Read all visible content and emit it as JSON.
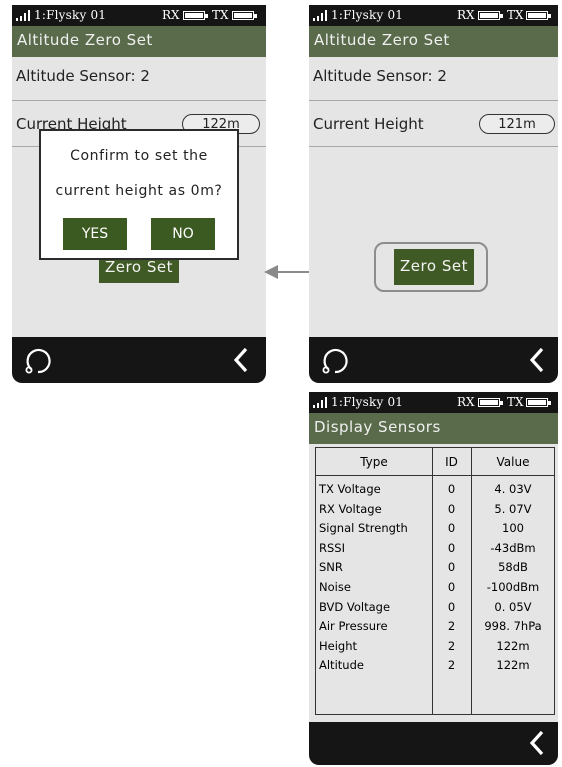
{
  "status_bar": {
    "model_name": "1:Flysky 01",
    "rx_label": "RX",
    "tx_label": "TX"
  },
  "screen_a": {
    "title": "Altitude Zero Set",
    "sensor_label": "Altitude Sensor: 2",
    "height_label": "Current Height",
    "height_value": "122m",
    "zero_button": "Zero Set",
    "dialog": {
      "line1": "Confirm to set the",
      "line2": "current height as 0m?",
      "yes": "YES",
      "no": "NO"
    }
  },
  "screen_b": {
    "title": "Altitude Zero Set",
    "sensor_label": "Altitude Sensor: 2",
    "height_label": "Current Height",
    "height_value": "121m",
    "zero_button": "Zero Set"
  },
  "screen_c": {
    "title": "Display Sensors",
    "columns": [
      "Type",
      "ID",
      "Value"
    ],
    "rows": [
      {
        "type": "TX Voltage",
        "id": "0",
        "value": "4. 03V"
      },
      {
        "type": "RX Voltage",
        "id": "0",
        "value": "5. 07V"
      },
      {
        "type": "Signal Strength",
        "id": "0",
        "value": "100"
      },
      {
        "type": "RSSI",
        "id": "0",
        "value": "-43dBm"
      },
      {
        "type": "SNR",
        "id": "0",
        "value": "58dB"
      },
      {
        "type": "Noise",
        "id": "0",
        "value": "-100dBm"
      },
      {
        "type": "BVD Voltage",
        "id": "0",
        "value": "0. 05V"
      },
      {
        "type": "Air Pressure",
        "id": "2",
        "value": "998. 7hPa"
      },
      {
        "type": "Height",
        "id": "2",
        "value": "122m"
      },
      {
        "type": "Altitude",
        "id": "2",
        "value": "122m"
      }
    ]
  },
  "colors": {
    "title_bar": "#5a6b4b",
    "button": "#3f5a24",
    "screen_bg": "#e5e5e5",
    "bar_bg": "#151515"
  },
  "icons": {
    "home": "circle-arrow-icon",
    "back": "chevron-left-icon",
    "flow": "arrow-left-icon"
  }
}
